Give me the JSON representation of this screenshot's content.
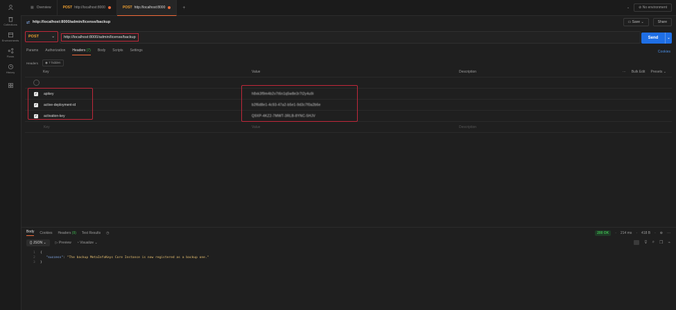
{
  "sidebar": {
    "items": [
      {
        "label": "Collections",
        "icon": "trash-icon"
      },
      {
        "label": "Environments",
        "icon": "environment-icon"
      },
      {
        "label": "Flows",
        "icon": "flows-icon"
      },
      {
        "label": "History",
        "icon": "history-icon"
      },
      {
        "label": "",
        "icon": "grid-icon"
      }
    ]
  },
  "tabs": [
    {
      "label": "Overview",
      "method": ""
    },
    {
      "label": "http://localhost:8000",
      "method": "POST"
    },
    {
      "label": "http://localhost:8000",
      "method": "POST"
    }
  ],
  "env": {
    "label": "No environment"
  },
  "request": {
    "title": "http://localhost:8000/admin/license/backup",
    "method": "POST",
    "url": "http://localhost:8000/admin/license/backup",
    "save_label": "Save",
    "share_label": "Share",
    "send_label": "Send"
  },
  "request_tabs": [
    "Params",
    "Authorization",
    "Headers",
    "(7)",
    "Body",
    "Scripts",
    "Settings"
  ],
  "cookies_label": "Cookies",
  "headers_sub": {
    "label": "Headers",
    "hidden": "7 hidden"
  },
  "headers_table": {
    "columns": {
      "key": "Key",
      "value": "Value",
      "description": "Description"
    },
    "tools": {
      "bulk": "Bulk Edit",
      "presets": "Presets"
    },
    "rows": [
      {
        "key": "apikey",
        "value": "h8xk3f9m4b2v7t6n1q5w8e3r7t2y4u9i"
      },
      {
        "key": "active-deployment-id",
        "value": "b2f6d8e1-4c93-47a2-b5e1-9d3c7f0a2b6e"
      },
      {
        "key": "activation-key",
        "value": "Q9XP-4KZ2-7MWT-3RLB-8YNC-5HJV"
      }
    ],
    "placeholder": {
      "key": "Key",
      "value": "Value",
      "description": "Description"
    }
  },
  "response": {
    "tabs": [
      "Body",
      "Cookies",
      "Headers",
      "(9)",
      "Test Results"
    ],
    "status": "200 OK",
    "time": "214 ms",
    "size": "418 B",
    "format": "JSON",
    "preview_label": "Preview",
    "visualize_label": "Visualize",
    "lines": [
      {
        "n": "1",
        "text": "{"
      },
      {
        "n": "2",
        "key": "\"success\"",
        "value": "\"The backup MetaInfoKeys Core Instance is now registered as a backup one.\""
      },
      {
        "n": "3",
        "text": "}"
      }
    ]
  }
}
